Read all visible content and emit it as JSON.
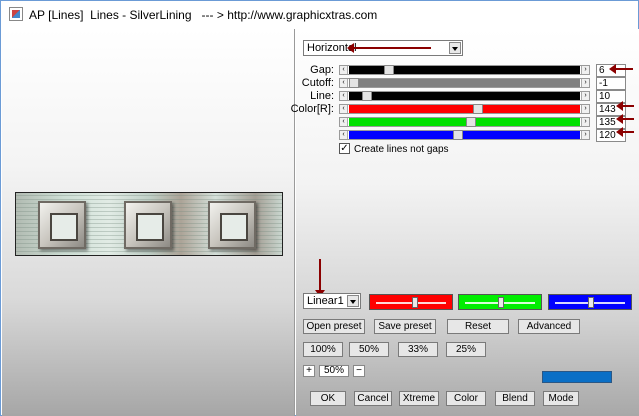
{
  "window": {
    "title": "AP [Lines]  Lines - SilverLining   --- > http://www.graphicxtras.com"
  },
  "direction_select": {
    "value": "Horizontal"
  },
  "rows": [
    {
      "label": "Gap:",
      "value": "6",
      "fraction": 0.16,
      "fill_color": "#000000",
      "rest_color": "#000000"
    },
    {
      "label": "Cutoff:",
      "value": "-1",
      "fraction": 0.0,
      "fill_color": "#ffffff",
      "rest_color": "#808080"
    },
    {
      "label": "Line:",
      "value": "10",
      "fraction": 0.06,
      "fill_color": "#000000",
      "rest_color": "#000000"
    },
    {
      "label": "Color[R]:",
      "value": "143",
      "fraction": 0.56,
      "fill_color": "#ff0000",
      "rest_color": "#ff0000"
    },
    {
      "label": "",
      "value": "135",
      "fraction": 0.53,
      "fill_color": "#00e000",
      "rest_color": "#00e000"
    },
    {
      "label": "",
      "value": "120",
      "fraction": 0.47,
      "fill_color": "#0000ff",
      "rest_color": "#0000ff"
    }
  ],
  "checkbox": {
    "label": "Create lines not gaps",
    "checked_glyph": "✓"
  },
  "preset_select": {
    "value": "Linear1"
  },
  "color_sliders": [
    {
      "color": "#ff0000",
      "fraction": 0.55
    },
    {
      "color": "#00ee00",
      "fraction": 0.5
    },
    {
      "color": "#0000ff",
      "fraction": 0.5
    }
  ],
  "buttons_row1": [
    "Open preset",
    "Save preset",
    "Reset",
    "Advanced"
  ],
  "zoom_buttons": [
    "100%",
    "50%",
    "33%",
    "25%"
  ],
  "zoom": {
    "plus": "+",
    "value": "50%",
    "minus": "−"
  },
  "footer_buttons": [
    "OK",
    "Cancel",
    "Xtreme",
    "Color",
    "Blend",
    "Mode"
  ],
  "colors": {
    "annotation_arrow": "#8b0000",
    "accent_bar": "#0a6fc6"
  }
}
